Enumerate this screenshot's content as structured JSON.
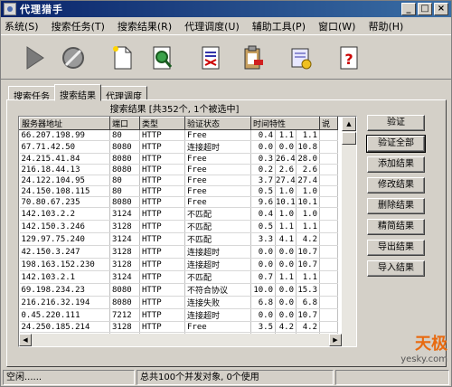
{
  "window": {
    "title": "代理猎手"
  },
  "title_buttons": {
    "min": "_",
    "max": "□",
    "close": "×"
  },
  "menu": [
    "系统(S)",
    "搜索任务(T)",
    "搜索结果(R)",
    "代理调度(U)",
    "辅助工具(P)",
    "窗口(W)",
    "帮助(H)"
  ],
  "toolbar": [
    "play-icon",
    "stop-icon",
    "new-document-icon",
    "search-icon",
    "delete-doc-icon",
    "clipboard-icon",
    "settings-icon",
    "help-icon"
  ],
  "tabs": [
    "搜索任务",
    "搜索结果",
    "代理调度"
  ],
  "active_tab": "搜索结果",
  "group_title": "搜索结果 [共352个, 1个被选中]",
  "table": {
    "columns": [
      "服务器地址",
      "端口",
      "类型",
      "验证状态",
      "时间特性",
      "",
      "",
      "说"
    ],
    "rows": [
      [
        "66.207.198.99",
        "80",
        "HTTP",
        "Free",
        "0.4",
        "1.1",
        "1.1"
      ],
      [
        "67.71.42.50",
        "8080",
        "HTTP",
        "连接超时",
        "0.0",
        "0.0",
        "10.8"
      ],
      [
        "24.215.41.84",
        "8080",
        "HTTP",
        "Free",
        "0.3",
        "26.4",
        "28.0"
      ],
      [
        "216.18.44.13",
        "8080",
        "HTTP",
        "Free",
        "0.2",
        "2.6",
        "2.6"
      ],
      [
        "24.122.104.95",
        "80",
        "HTTP",
        "Free",
        "3.7",
        "27.4",
        "27.4"
      ],
      [
        "24.150.108.115",
        "80",
        "HTTP",
        "Free",
        "0.5",
        "1.0",
        "1.0"
      ],
      [
        "70.80.67.235",
        "8080",
        "HTTP",
        "Free",
        "9.6",
        "10.1",
        "10.1"
      ],
      [
        "142.103.2.2",
        "3124",
        "HTTP",
        "不匹配",
        "0.4",
        "1.0",
        "1.0"
      ],
      [
        "142.150.3.246",
        "3128",
        "HTTP",
        "不匹配",
        "0.5",
        "1.1",
        "1.1"
      ],
      [
        "129.97.75.240",
        "3124",
        "HTTP",
        "不匹配",
        "3.3",
        "4.1",
        "4.2"
      ],
      [
        "42.150.3.247",
        "3128",
        "HTTP",
        "连接超时",
        "0.0",
        "0.0",
        "10.7"
      ],
      [
        "198.163.152.230",
        "3128",
        "HTTP",
        "连接超时",
        "0.0",
        "0.0",
        "10.7"
      ],
      [
        "142.103.2.1",
        "3124",
        "HTTP",
        "不匹配",
        "0.7",
        "1.1",
        "1.1"
      ],
      [
        "69.198.234.23",
        "8080",
        "HTTP",
        "不符合协议",
        "10.0",
        "0.0",
        "15.3"
      ],
      [
        "216.216.32.194",
        "8080",
        "HTTP",
        "连接失败",
        "6.8",
        "0.0",
        "6.8"
      ],
      [
        "0.45.220.111",
        "7212",
        "HTTP",
        "连接超时",
        "0.0",
        "0.0",
        "10.7"
      ],
      [
        "24.250.185.214",
        "3128",
        "HTTP",
        "Free",
        "3.5",
        "4.2",
        "4.2"
      ],
      [
        "69.79.190.98",
        "65",
        "HTTP",
        "连接超时",
        "0.0",
        "0.0",
        "10.6"
      ]
    ]
  },
  "actions": [
    "验证",
    "验证全部",
    "添加结果",
    "修改结果",
    "删除结果",
    "精简结果",
    "导出结果",
    "导入结果"
  ],
  "status": {
    "left": "空闲......",
    "mid": "总共100个并发对象, 0个使用",
    "right": ""
  },
  "watermark": {
    "brand": "天极",
    "url": "yesky.com"
  }
}
